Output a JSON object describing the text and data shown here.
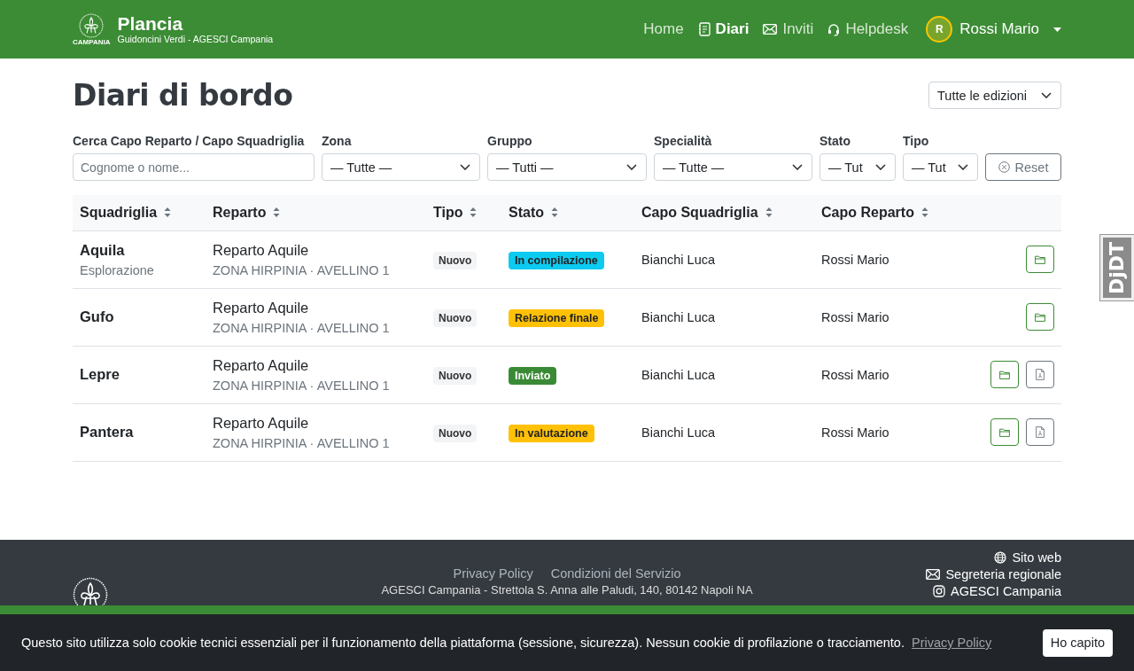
{
  "header": {
    "logo_caption": "CAMPANIA",
    "title": "Plancia",
    "subtitle": "Guidoncini Verdi - AGESCI Campania",
    "nav": [
      {
        "kind": "plain",
        "label": "Home",
        "selected": false
      },
      {
        "kind": "notebook",
        "label": "Diari",
        "selected": true
      },
      {
        "kind": "envelope",
        "label": "Inviti",
        "selected": false
      },
      {
        "kind": "headset",
        "label": "Helpdesk",
        "selected": false
      }
    ],
    "user": {
      "initial": "R",
      "name": "Rossi Mario"
    }
  },
  "page": {
    "title": "Diari di bordo",
    "edition_select": "Tutte le edizioni"
  },
  "filters": [
    {
      "kind": "text",
      "label": "Cerca Capo Reparto / Capo Squadriglia",
      "placeholder": "Cognome o nome..."
    },
    {
      "kind": "select",
      "label": "Zona",
      "value": "— Tutte —"
    },
    {
      "kind": "select",
      "label": "Gruppo",
      "value": "— Tutti —"
    },
    {
      "kind": "select",
      "label": "Specialità",
      "value": "— Tutte —"
    },
    {
      "kind": "select",
      "label": "Stato",
      "value": "— Tut"
    },
    {
      "kind": "select",
      "label": "Tipo",
      "value": "— Tut"
    }
  ],
  "reset_button": "Reset",
  "table": {
    "columns": [
      "Squadriglia",
      "Reparto",
      "Tipo",
      "Stato",
      "Capo Squadriglia",
      "Capo Reparto"
    ],
    "rows": [
      {
        "squadriglia": "Aquila",
        "specialita": "Esplorazione",
        "reparto": "Reparto Aquile",
        "zona": "ZONA HIRPINIA · AVELLINO 1",
        "tipo": "Nuovo",
        "stato": {
          "label": "In compilazione",
          "color": "#0dcaf0"
        },
        "capo_squadriglia": "Bianchi Luca",
        "capo_reparto": "Rossi Mario",
        "actions": [
          {
            "kind": "folder"
          }
        ]
      },
      {
        "squadriglia": "Gufo",
        "reparto": "Reparto Aquile",
        "zona": "ZONA HIRPINIA · AVELLINO 1",
        "tipo": "Nuovo",
        "stato": {
          "label": "Relazione finale",
          "color": "#ffc107"
        },
        "capo_squadriglia": "Bianchi Luca",
        "capo_reparto": "Rossi Mario",
        "actions": [
          {
            "kind": "folder"
          }
        ]
      },
      {
        "squadriglia": "Lepre",
        "reparto": "Reparto Aquile",
        "zona": "ZONA HIRPINIA · AVELLINO 1",
        "tipo": "Nuovo",
        "stato": {
          "label": "Inviato",
          "color": "#3a8a35"
        },
        "capo_squadriglia": "Bianchi Luca",
        "capo_reparto": "Rossi Mario",
        "actions": [
          {
            "kind": "folder"
          },
          {
            "kind": "pdf"
          }
        ]
      },
      {
        "squadriglia": "Pantera",
        "reparto": "Reparto Aquile",
        "zona": "ZONA HIRPINIA · AVELLINO 1",
        "tipo": "Nuovo",
        "stato": {
          "label": "In valutazione",
          "color": "#ffc107"
        },
        "capo_squadriglia": "Bianchi Luca",
        "capo_reparto": "Rossi Mario",
        "actions": [
          {
            "kind": "folder"
          },
          {
            "kind": "pdf"
          }
        ]
      }
    ]
  },
  "footer": {
    "links": [
      "Privacy Policy",
      "Condizioni del Servizio"
    ],
    "address": "AGESCI Campania - Strettola S. Anna alle Paludi, 140, 80142 Napoli NA",
    "contacts": [
      {
        "kind": "globe",
        "label": "Sito web"
      },
      {
        "kind": "envelope",
        "label": "Segreteria regionale"
      },
      {
        "kind": "instagram",
        "label": "AGESCI Campania"
      }
    ]
  },
  "cookie_banner": {
    "text": "Questo sito utilizza solo cookie tecnici essenziali per il funzionamento della piattaforma (sessione, sicurezza). Nessun cookie di profilazione o tracciamento.",
    "link": "Privacy Policy",
    "button": "Ho capito"
  },
  "debug_toolbar": {
    "label": "DjDT"
  }
}
